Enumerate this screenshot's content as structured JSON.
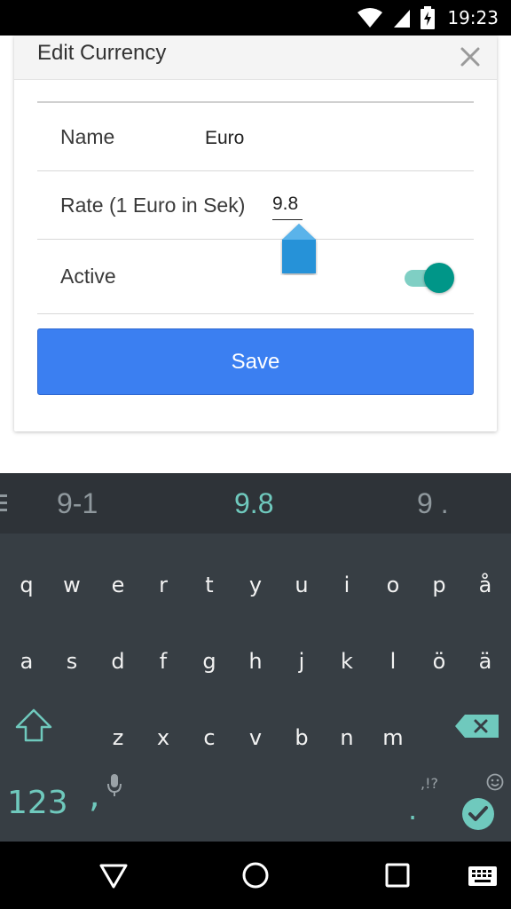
{
  "status_bar": {
    "time": "19:23",
    "icons": [
      "wifi-icon",
      "cell-signal-icon",
      "battery-charging-icon"
    ]
  },
  "dialog": {
    "title": "Edit Currency",
    "close_icon": "close-icon",
    "fields": {
      "name_label": "Name",
      "name_value": "Euro",
      "rate_label": "Rate (1 Euro in Sek)",
      "rate_value": "9.8",
      "active_label": "Active",
      "active_on": true
    },
    "save_label": "Save"
  },
  "keyboard": {
    "suggestions": [
      "9-1",
      "9.8",
      "9 ."
    ],
    "row1": [
      "q",
      "w",
      "e",
      "r",
      "t",
      "y",
      "u",
      "i",
      "o",
      "p",
      "å"
    ],
    "row2": [
      "a",
      "s",
      "d",
      "f",
      "g",
      "h",
      "j",
      "k",
      "l",
      "ö",
      "ä"
    ],
    "row3": [
      "z",
      "x",
      "c",
      "v",
      "b",
      "n",
      "m"
    ],
    "symbols_key": "123",
    "comma_key": ",",
    "period_key": ".",
    "punct_hint": ",!?"
  },
  "colors": {
    "accent_blue": "#3b7ff1",
    "toggle_teal": "#009688",
    "keyboard_bg": "#373e44",
    "keyboard_accent": "#6fc9bd"
  },
  "nav_bar": {
    "icons": [
      "back-icon",
      "home-icon",
      "recents-icon",
      "keyboard-switch-icon"
    ]
  }
}
